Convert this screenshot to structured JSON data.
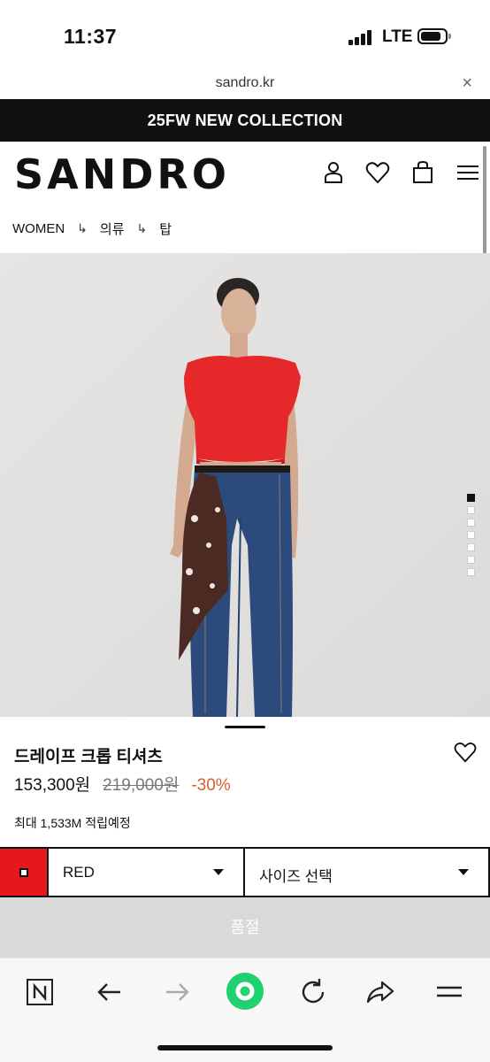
{
  "status_bar": {
    "time": "11:37",
    "network": "LTE"
  },
  "browser": {
    "url": "sandro.kr",
    "close_glyph": "×"
  },
  "promo_banner": {
    "text": "25FW NEW COLLECTION"
  },
  "header": {
    "logo": "SANDRO",
    "icons": [
      "account-icon",
      "heart-icon",
      "shopping-bag-icon",
      "menu-icon"
    ]
  },
  "breadcrumb": {
    "items": [
      "WOMEN",
      "의류",
      "탑"
    ],
    "separator": "↳"
  },
  "gallery": {
    "slide_count": 7,
    "active_index": 0
  },
  "product": {
    "name": "드레이프 크롭 티셔츠",
    "price": "153,300원",
    "original_price": "219,000원",
    "discount": "-30%",
    "points": "최대 1,533M 적립예정"
  },
  "selectors": {
    "color_value": "RED",
    "color_hex": "#e6181c",
    "size_placeholder": "사이즈 선택"
  },
  "cta": {
    "label": "품절"
  },
  "colors": {
    "discount": "#d65f2a",
    "promo_bg": "#111111",
    "soldout_bg": "#d9d9d9",
    "toolbar_green": "#1fd16f"
  },
  "toolbar": {
    "icons": [
      "naver-n-icon",
      "back-arrow-icon",
      "forward-arrow-icon",
      "naver-green-dot-icon",
      "reload-icon",
      "share-icon",
      "menu-lines-icon"
    ]
  }
}
